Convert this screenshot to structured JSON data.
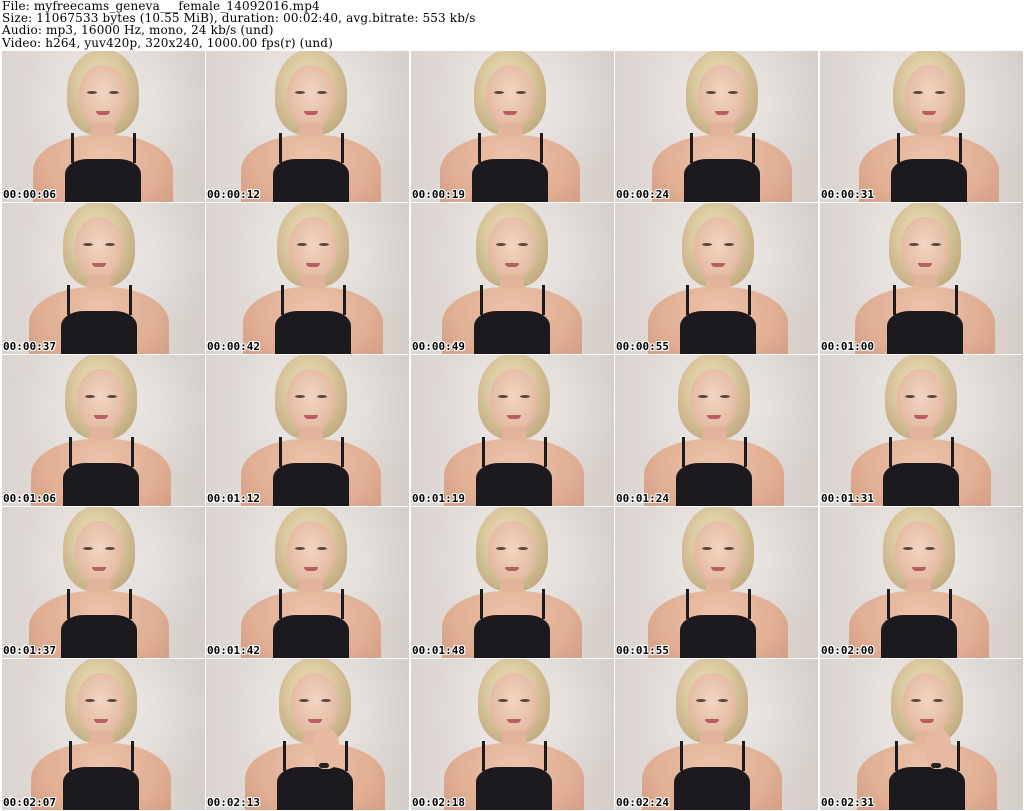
{
  "header": {
    "file_line": "File: myfreecams_geneva___female_14092016.mp4",
    "size_line": "Size: 11067533 bytes (10.55 MiB), duration: 00:02:40, avg.bitrate: 553 kb/s",
    "audio_line": "Audio: mp3, 16000 Hz, mono, 24 kb/s (und)",
    "video_line": "Video: h264, yuv420p, 320x240, 1000.00 fps(r) (und)"
  },
  "thumbnails": [
    {
      "timestamp": "00:00:06"
    },
    {
      "timestamp": "00:00:12"
    },
    {
      "timestamp": "00:00:19"
    },
    {
      "timestamp": "00:00:24"
    },
    {
      "timestamp": "00:00:31"
    },
    {
      "timestamp": "00:00:37"
    },
    {
      "timestamp": "00:00:42"
    },
    {
      "timestamp": "00:00:49"
    },
    {
      "timestamp": "00:00:55"
    },
    {
      "timestamp": "00:01:00"
    },
    {
      "timestamp": "00:01:06"
    },
    {
      "timestamp": "00:01:12"
    },
    {
      "timestamp": "00:01:19"
    },
    {
      "timestamp": "00:01:24"
    },
    {
      "timestamp": "00:01:31"
    },
    {
      "timestamp": "00:01:37"
    },
    {
      "timestamp": "00:01:42"
    },
    {
      "timestamp": "00:01:48"
    },
    {
      "timestamp": "00:01:55"
    },
    {
      "timestamp": "00:02:00"
    },
    {
      "timestamp": "00:02:07"
    },
    {
      "timestamp": "00:02:13"
    },
    {
      "timestamp": "00:02:18"
    },
    {
      "timestamp": "00:02:24"
    },
    {
      "timestamp": "00:02:31"
    }
  ]
}
